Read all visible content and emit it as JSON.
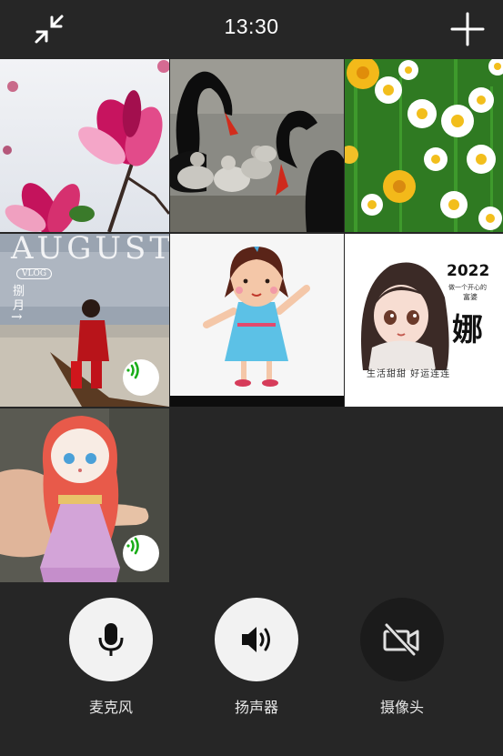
{
  "header": {
    "time": "13:30",
    "collapse_icon": "collapse-arrows-icon",
    "add_icon": "plus-icon"
  },
  "participants": [
    {
      "name": "participant-magnolia",
      "subject": "pink magnolia flowers",
      "speaking": false
    },
    {
      "name": "participant-swans",
      "subject": "black swans with cygnets",
      "speaking": false
    },
    {
      "name": "participant-daisies",
      "subject": "daisies and yellow flowers",
      "speaking": false
    },
    {
      "name": "participant-august",
      "subject": "woman in red on boat",
      "speaking": true,
      "overlay": {
        "title": "AUGUST",
        "sub": "VLOG",
        "cn1": "捌",
        "cn2": "月",
        "arrow": "→"
      }
    },
    {
      "name": "participant-cartoon-girl",
      "subject": "cartoon girl in blue dress",
      "speaking": false
    },
    {
      "name": "participant-2022",
      "subject": "cartoon girl with text",
      "speaking": false,
      "overlay": {
        "year": "2022",
        "line1": "做一个开心的",
        "line2": "富婆",
        "big": "娜",
        "bottom": "生活甜甜 好运连连"
      }
    },
    {
      "name": "participant-doll",
      "subject": "pink dress doll figure",
      "speaking": true
    }
  ],
  "controls": [
    {
      "id": "mic",
      "label": "麦克风",
      "icon": "microphone-icon",
      "state": "on"
    },
    {
      "id": "speaker",
      "label": "扬声器",
      "icon": "speaker-icon",
      "state": "on"
    },
    {
      "id": "camera",
      "label": "摄像头",
      "icon": "camera-off-icon",
      "state": "off"
    }
  ],
  "colors": {
    "background": "#262626",
    "button_on": "#f2f2f2",
    "button_off": "#1b1b1b",
    "speaking_indicator": "#1aad19"
  }
}
